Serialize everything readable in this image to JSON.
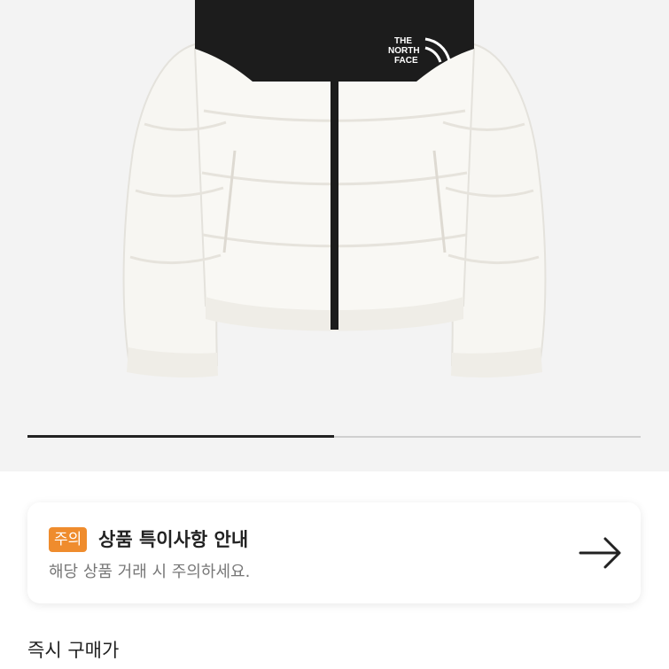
{
  "product": {
    "image_name": "white-black-puffer-jacket",
    "brand_logo_text": "THE NORTH FACE"
  },
  "gallery": {
    "progress": 0.5
  },
  "notice": {
    "badge": "주의",
    "title": "상품 특이사항 안내",
    "subtitle": "해당 상품 거래 시 주의하세요.",
    "arrow_icon": "arrow-right-icon",
    "badge_color": "#ef8c2d"
  },
  "section": {
    "title": "즉시 구매가"
  }
}
